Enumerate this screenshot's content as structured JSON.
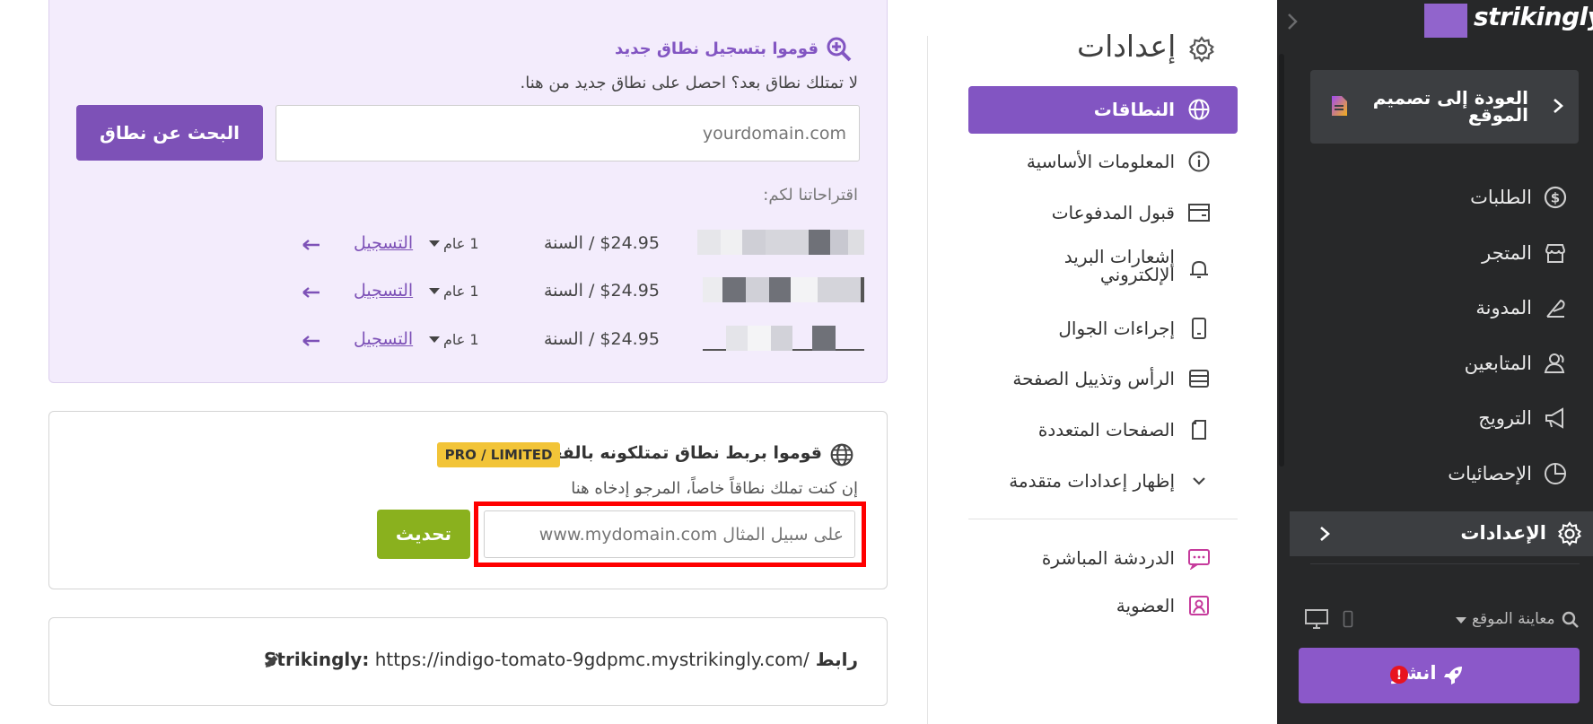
{
  "app": {
    "logo_text": "strikingly",
    "back_label": "العودة إلى تصميم الموقع"
  },
  "sidebar": {
    "items": [
      {
        "label": "الطلبات",
        "icon": "dollar-icon"
      },
      {
        "label": "المتجر",
        "icon": "store-icon"
      },
      {
        "label": "المدونة",
        "icon": "feather-icon"
      },
      {
        "label": "المتابعين",
        "icon": "users-icon"
      },
      {
        "label": "الترويج",
        "icon": "megaphone-icon"
      },
      {
        "label": "الإحصائيات",
        "icon": "pie-chart-icon"
      }
    ],
    "settings_label": "الإعدادات",
    "preview_label": "معاينة الموقع",
    "publish_label": "انشر",
    "publish_alert": "!"
  },
  "settings_nav": {
    "title": "إعدادات",
    "items": [
      {
        "label": "النطاقات",
        "icon": "globe-icon",
        "active": true
      },
      {
        "label": "المعلومات الأساسية",
        "icon": "info-icon"
      },
      {
        "label": "قبول المدفوعات",
        "icon": "card-icon"
      },
      {
        "label": "إشعارات البريد الإلكتروني",
        "icon": "bell-icon"
      },
      {
        "label": "إجراءات الجوال",
        "icon": "mobile-icon"
      },
      {
        "label": "الرأس وتذييل الصفحة",
        "icon": "layout-icon"
      },
      {
        "label": "الصفحات المتعددة",
        "icon": "pages-icon"
      },
      {
        "label": "إظهار إعدادات متقدمة",
        "icon": "chevron-down-icon"
      }
    ],
    "extra_items": [
      {
        "label": "الدردشة المباشرة",
        "icon": "chat-icon"
      },
      {
        "label": "العضوية",
        "icon": "member-icon"
      }
    ]
  },
  "register": {
    "title": "قوموا بتسجيل نطاق جديد",
    "subtitle": "لا تمتلك نطاق بعد؟ احصل على نطاق جديد من هنا.",
    "search_placeholder": "yourdomain.com",
    "search_button": "البحث عن نطاق",
    "suggestions_title": "اقتراحاتنا لكم:",
    "suggestions": [
      {
        "price": "$24.95 / السنة",
        "years": "1 عام",
        "action": "التسجيل"
      },
      {
        "price": "$24.95 / السنة",
        "years": "1 عام",
        "action": "التسجيل"
      },
      {
        "price": "$24.95 / السنة",
        "years": "1 عام",
        "action": "التسجيل"
      }
    ]
  },
  "connect": {
    "title": "قوموا بربط نطاق تمتلكونه بالفعل",
    "badge": "PRO / LIMITED",
    "subtitle": "إن كنت تملك نطاقاً خاصاً، المرجو إدخاه هنا",
    "input_placeholder": "على سبيل المثال www.mydomain.com",
    "update_button": "تحديث"
  },
  "url": {
    "label": "رابط Strikingly:",
    "value": "https://indigo-tomato-9gdpmc.mystrikingly.com/"
  },
  "colors": {
    "sidebar_bg": "#272829",
    "accent_purple": "#8255c2",
    "update_green": "#8ab11e",
    "badge_yellow": "#f2c438",
    "highlight_red": "#ff0000"
  }
}
